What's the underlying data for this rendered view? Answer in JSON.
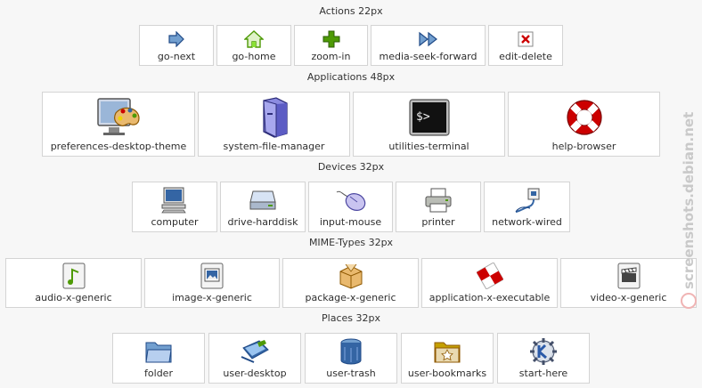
{
  "sections": {
    "actions": {
      "title": "Actions 22px",
      "items": [
        "go-next",
        "go-home",
        "zoom-in",
        "media-seek-forward",
        "edit-delete"
      ]
    },
    "applications": {
      "title": "Applications 48px",
      "items": [
        "preferences-desktop-theme",
        "system-file-manager",
        "utilities-terminal",
        "help-browser"
      ]
    },
    "devices": {
      "title": "Devices 32px",
      "items": [
        "computer",
        "drive-harddisk",
        "input-mouse",
        "printer",
        "network-wired"
      ]
    },
    "mimetypes": {
      "title": "MIME-Types 32px",
      "items": [
        "audio-x-generic",
        "image-x-generic",
        "package-x-generic",
        "application-x-executable",
        "video-x-generic"
      ]
    },
    "places": {
      "title": "Places 32px",
      "items": [
        "folder",
        "user-desktop",
        "user-trash",
        "user-bookmarks",
        "start-here"
      ]
    }
  },
  "watermark": "screenshots.debian.net",
  "colors": {
    "tile_border": "#d4d4d4",
    "background": "#f7f7f7",
    "blue": "#3465a4",
    "green": "#4e9a06",
    "red": "#cc0000"
  }
}
